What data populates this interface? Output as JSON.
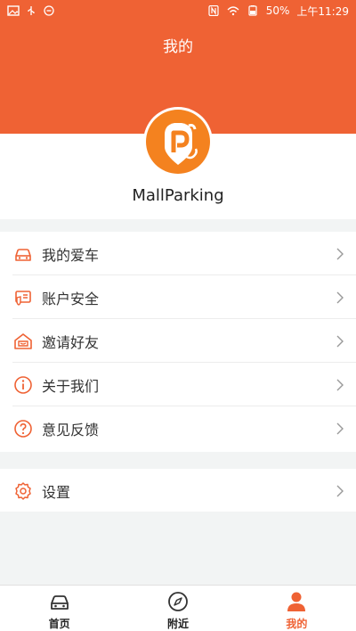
{
  "status_bar": {
    "battery": "50%",
    "time": "上午11:29"
  },
  "header": {
    "title": "我的"
  },
  "profile": {
    "name": "MallParking"
  },
  "menu": {
    "items": [
      {
        "label": "我的爱车",
        "icon": "car-icon"
      },
      {
        "label": "账户安全",
        "icon": "shield-card-icon"
      },
      {
        "label": "邀请好友",
        "icon": "invite-house-icon"
      },
      {
        "label": "关于我们",
        "icon": "info-icon"
      },
      {
        "label": "意见反馈",
        "icon": "question-icon"
      }
    ],
    "settings": {
      "label": "设置",
      "icon": "gear-icon"
    }
  },
  "bottom_nav": {
    "items": [
      {
        "label": "首页",
        "icon": "car-icon"
      },
      {
        "label": "附近",
        "icon": "compass-icon"
      },
      {
        "label": "我的",
        "icon": "person-icon"
      }
    ],
    "active": "我的"
  },
  "colors": {
    "accent": "#ef6234",
    "logo_orange": "#f4821f",
    "background": "#f2f4f4"
  }
}
